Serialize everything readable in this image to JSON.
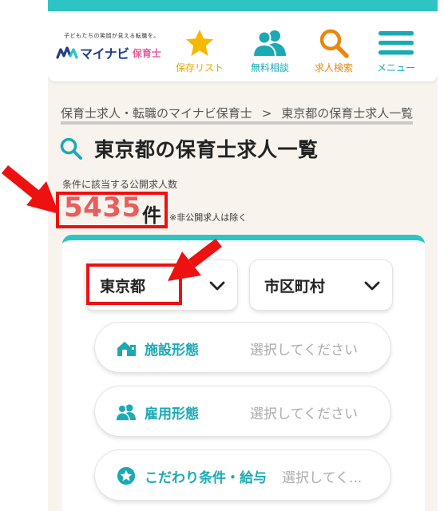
{
  "header": {
    "logo_tagline": "子どもたちの笑顔が見える転職を。",
    "logo_brand": "マイナビ",
    "logo_sub": "保育士",
    "nav": [
      {
        "label": "保存リスト",
        "icon": "star-icon",
        "color": "#f0a500"
      },
      {
        "label": "無料相談",
        "icon": "users-icon",
        "color": "#1aaab5"
      },
      {
        "label": "求人検索",
        "icon": "search-icon",
        "color": "#e8890c"
      },
      {
        "label": "メニュー",
        "icon": "hamburger-menu-icon",
        "color": "#1aaab5"
      }
    ]
  },
  "breadcrumb": {
    "home": "保育士求人・転職のマイナビ保育士",
    "separator": ">",
    "current": "東京都の保育士求人一覧"
  },
  "title": "東京都の保育士求人一覧",
  "count": {
    "label": "条件に該当する公開求人数",
    "value": "5435",
    "unit": "件",
    "note": "※非公開求人は除く"
  },
  "filters": {
    "prefecture": "東京都",
    "city": "市区町村",
    "facility_type": {
      "label": "施設形態",
      "placeholder": "選択してください"
    },
    "employment_type": {
      "label": "雇用形態",
      "placeholder": "選択してください"
    },
    "preferences": {
      "label": "こだわり条件・給与",
      "placeholder": "選択してく..."
    }
  },
  "colors": {
    "teal": "#2ec4c4",
    "accent_text": "#1aaab5",
    "count_red": "#e85d5d",
    "highlight_red": "#ee1111",
    "background": "#f8f4ed"
  }
}
